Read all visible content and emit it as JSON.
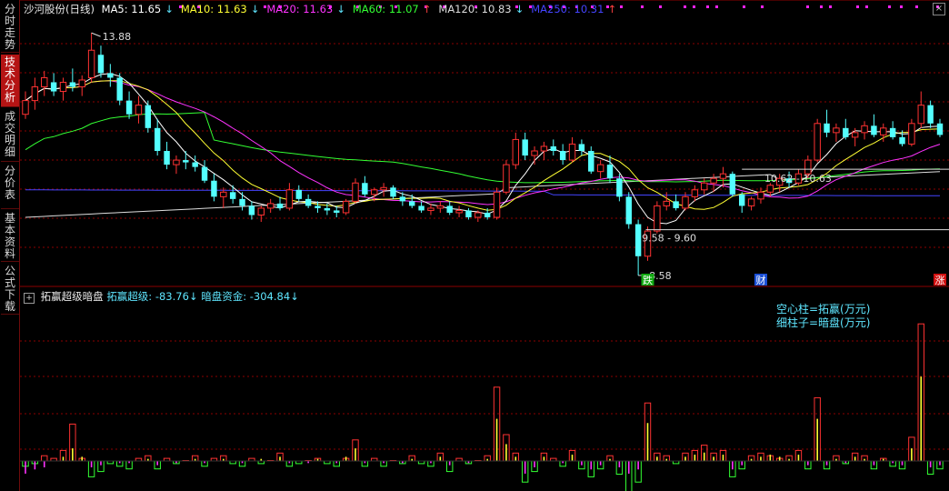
{
  "sidebar": {
    "tabs": [
      {
        "label": "分时走势",
        "active": false
      },
      {
        "label": "技术分析",
        "active": true
      },
      {
        "label": "成交明细",
        "active": false
      },
      {
        "label": "分价表",
        "active": false
      },
      {
        "label": "基本资料",
        "active": false
      },
      {
        "label": "公式下载",
        "active": false
      }
    ]
  },
  "main_header": {
    "title": "沙河股份(日线)",
    "ma": [
      {
        "label": "MA5: 11.65",
        "arrow": "↓",
        "color": "#ffffff"
      },
      {
        "label": "MA10: 11.63",
        "arrow": "↓",
        "color": "#ffff33"
      },
      {
        "label": "MA20: 11.63",
        "arrow": "↓",
        "color": "#ff33ff"
      },
      {
        "label": "MA60: 11.07",
        "arrow": "↑",
        "color": "#33ff33"
      },
      {
        "label": "MA120: 10.83",
        "arrow": "↓",
        "color": "#dddddd"
      },
      {
        "label": "MA250: 10.31",
        "arrow": "↑",
        "color": "#4444ff"
      }
    ]
  },
  "annotations": {
    "high": "13.88",
    "low": "8.58",
    "range1": "9.58 - 9.60",
    "range2": "10.62 - 10.63",
    "markers": [
      {
        "text": "跌",
        "color": "#11aa11"
      },
      {
        "text": "财",
        "color": "#1a4fd6"
      },
      {
        "text": "涨",
        "color": "#d01010"
      }
    ]
  },
  "indicator": {
    "title": "拓赢超级暗盘",
    "value1_label": "拓赢超级: -83.76",
    "value1_arrow": "↓",
    "value2_label": "暗盘资金: -304.84",
    "value2_arrow": "↓",
    "legend": [
      "空心柱=拓赢(万元)",
      "细柱子=暗盘(万元)"
    ]
  },
  "colors": {
    "up": "#ff3232",
    "down": "#54ffff",
    "ma5": "#ffffff",
    "ma10": "#ffff33",
    "ma20": "#ff33ff",
    "ma60": "#33ff33",
    "ma120": "#dddddd",
    "ma250": "#4444ff",
    "grid": "#8b0000"
  },
  "chart_data": {
    "type": "candlestick",
    "ylim": [
      8.4,
      14.2
    ],
    "ohlc": [
      [
        12.1,
        12.6,
        12.0,
        12.4
      ],
      [
        12.4,
        12.9,
        12.2,
        12.7
      ],
      [
        12.7,
        13.05,
        12.5,
        12.9
      ],
      [
        12.8,
        13.0,
        12.5,
        12.6
      ],
      [
        12.6,
        12.9,
        12.4,
        12.8
      ],
      [
        12.8,
        13.1,
        12.6,
        12.7
      ],
      [
        12.7,
        12.95,
        12.5,
        12.85
      ],
      [
        12.9,
        13.88,
        12.8,
        13.5
      ],
      [
        13.4,
        13.6,
        12.9,
        13.0
      ],
      [
        13.0,
        13.2,
        12.7,
        12.9
      ],
      [
        12.9,
        13.0,
        12.3,
        12.4
      ],
      [
        12.4,
        12.6,
        12.0,
        12.1
      ],
      [
        12.1,
        12.5,
        11.9,
        12.3
      ],
      [
        12.3,
        12.4,
        11.7,
        11.8
      ],
      [
        11.8,
        12.0,
        11.2,
        11.3
      ],
      [
        11.3,
        11.5,
        10.9,
        11.0
      ],
      [
        11.0,
        11.2,
        10.8,
        11.1
      ],
      [
        11.1,
        11.3,
        10.9,
        11.05
      ],
      [
        11.05,
        11.2,
        10.85,
        10.95
      ],
      [
        10.95,
        11.1,
        10.6,
        10.65
      ],
      [
        10.65,
        10.8,
        10.2,
        10.3
      ],
      [
        10.3,
        10.5,
        10.05,
        10.4
      ],
      [
        10.4,
        10.55,
        10.15,
        10.25
      ],
      [
        10.25,
        10.4,
        10.0,
        10.1
      ],
      [
        10.1,
        10.2,
        9.8,
        9.9
      ],
      [
        9.9,
        10.1,
        9.75,
        10.05
      ],
      [
        10.05,
        10.25,
        9.95,
        10.15
      ],
      [
        10.15,
        10.3,
        10.0,
        10.05
      ],
      [
        10.05,
        10.6,
        10.0,
        10.45
      ],
      [
        10.45,
        10.55,
        10.2,
        10.25
      ],
      [
        10.25,
        10.35,
        10.05,
        10.1
      ],
      [
        10.1,
        10.2,
        9.95,
        10.05
      ],
      [
        10.05,
        10.15,
        9.9,
        10.0
      ],
      [
        10.0,
        10.1,
        9.85,
        9.95
      ],
      [
        9.95,
        10.25,
        9.9,
        10.2
      ],
      [
        10.2,
        10.7,
        10.15,
        10.6
      ],
      [
        10.6,
        10.75,
        10.3,
        10.35
      ],
      [
        10.35,
        10.5,
        10.2,
        10.45
      ],
      [
        10.45,
        10.6,
        10.3,
        10.5
      ],
      [
        10.5,
        10.55,
        10.25,
        10.3
      ],
      [
        10.3,
        10.4,
        10.1,
        10.2
      ],
      [
        10.2,
        10.35,
        10.05,
        10.1
      ],
      [
        10.1,
        10.2,
        9.95,
        10.0
      ],
      [
        10.0,
        10.15,
        9.9,
        10.05
      ],
      [
        10.05,
        10.2,
        9.95,
        10.1
      ],
      [
        10.1,
        10.2,
        9.9,
        9.95
      ],
      [
        9.95,
        10.1,
        9.85,
        10.0
      ],
      [
        10.0,
        10.05,
        9.8,
        9.85
      ],
      [
        9.85,
        10.0,
        9.75,
        9.95
      ],
      [
        9.95,
        10.05,
        9.8,
        9.85
      ],
      [
        9.85,
        10.5,
        9.8,
        10.4
      ],
      [
        10.4,
        11.1,
        10.35,
        11.0
      ],
      [
        11.0,
        11.7,
        10.9,
        11.55
      ],
      [
        11.55,
        11.7,
        11.1,
        11.2
      ],
      [
        11.2,
        11.4,
        11.0,
        11.3
      ],
      [
        11.3,
        11.5,
        11.1,
        11.4
      ],
      [
        11.4,
        11.55,
        11.2,
        11.3
      ],
      [
        11.3,
        11.45,
        11.0,
        11.1
      ],
      [
        11.1,
        11.6,
        11.05,
        11.45
      ],
      [
        11.45,
        11.55,
        11.2,
        11.3
      ],
      [
        11.3,
        11.4,
        10.8,
        10.85
      ],
      [
        10.85,
        11.1,
        10.7,
        11.0
      ],
      [
        11.0,
        11.2,
        10.6,
        10.7
      ],
      [
        10.7,
        10.8,
        10.2,
        10.3
      ],
      [
        10.3,
        10.4,
        9.6,
        9.7
      ],
      [
        9.7,
        9.8,
        8.58,
        9.0
      ],
      [
        9.0,
        9.65,
        8.9,
        9.55
      ],
      [
        9.55,
        10.2,
        9.5,
        10.1
      ],
      [
        10.1,
        10.4,
        10.0,
        10.2
      ],
      [
        10.2,
        10.35,
        10.0,
        10.05
      ],
      [
        10.05,
        10.4,
        10.0,
        10.3
      ],
      [
        10.3,
        10.55,
        10.2,
        10.45
      ],
      [
        10.45,
        10.7,
        10.35,
        10.6
      ],
      [
        10.6,
        10.8,
        10.4,
        10.7
      ],
      [
        10.7,
        10.95,
        10.5,
        10.8
      ],
      [
        10.8,
        10.85,
        10.3,
        10.35
      ],
      [
        10.35,
        10.4,
        9.95,
        10.1
      ],
      [
        10.1,
        10.3,
        10.0,
        10.25
      ],
      [
        10.25,
        10.5,
        10.15,
        10.4
      ],
      [
        10.4,
        10.6,
        10.3,
        10.55
      ],
      [
        10.55,
        10.8,
        10.4,
        10.7
      ],
      [
        10.7,
        10.85,
        10.5,
        10.6
      ],
      [
        10.6,
        10.9,
        10.55,
        10.8
      ],
      [
        10.8,
        11.2,
        10.7,
        11.1
      ],
      [
        11.1,
        12.0,
        11.05,
        11.9
      ],
      [
        11.9,
        12.2,
        11.6,
        11.7
      ],
      [
        11.7,
        11.9,
        11.5,
        11.8
      ],
      [
        11.8,
        12.0,
        11.55,
        11.6
      ],
      [
        11.6,
        11.8,
        11.4,
        11.7
      ],
      [
        11.7,
        11.95,
        11.55,
        11.85
      ],
      [
        11.85,
        12.1,
        11.6,
        11.65
      ],
      [
        11.65,
        11.9,
        11.5,
        11.8
      ],
      [
        11.8,
        11.95,
        11.55,
        11.6
      ],
      [
        11.6,
        11.75,
        11.4,
        11.45
      ],
      [
        11.45,
        12.0,
        11.4,
        11.9
      ],
      [
        11.9,
        12.6,
        11.8,
        12.3
      ],
      [
        12.3,
        12.4,
        11.8,
        11.9
      ],
      [
        11.9,
        12.0,
        11.6,
        11.65
      ]
    ],
    "indicator_bars": [
      [
        -6,
        -2,
        0
      ],
      [
        -4,
        -1,
        1
      ],
      [
        -3,
        2,
        0
      ],
      [
        0,
        1,
        -1
      ],
      [
        2,
        4,
        1
      ],
      [
        6,
        14,
        3
      ],
      [
        2,
        1,
        0
      ],
      [
        -3,
        -6,
        -1
      ],
      [
        -2,
        -4,
        0
      ],
      [
        0,
        -1,
        1
      ],
      [
        -1,
        -2,
        0
      ],
      [
        -1,
        -3,
        -1
      ],
      [
        0,
        1,
        0
      ],
      [
        1,
        2,
        1
      ],
      [
        -2,
        -3,
        0
      ],
      [
        0,
        1,
        0
      ],
      [
        -1,
        -1,
        0
      ],
      [
        0,
        0,
        1
      ],
      [
        1,
        2,
        0
      ],
      [
        -1,
        -2,
        0
      ],
      [
        0,
        1,
        0
      ],
      [
        1,
        2,
        0
      ],
      [
        0,
        -1,
        0
      ],
      [
        -1,
        -2,
        0
      ],
      [
        0,
        1,
        0
      ],
      [
        1,
        -1,
        0
      ],
      [
        0,
        0,
        0
      ],
      [
        2,
        3,
        1
      ],
      [
        -1,
        -2,
        0
      ],
      [
        0,
        -1,
        0
      ],
      [
        -1,
        0,
        0
      ],
      [
        1,
        1,
        0
      ],
      [
        0,
        -1,
        0
      ],
      [
        -1,
        -2,
        0
      ],
      [
        2,
        1,
        0
      ],
      [
        6,
        8,
        3
      ],
      [
        -1,
        -2,
        0
      ],
      [
        0,
        1,
        0
      ],
      [
        -1,
        -2,
        0
      ],
      [
        0,
        0,
        0
      ],
      [
        -1,
        -1,
        0
      ],
      [
        1,
        2,
        0
      ],
      [
        0,
        -1,
        0
      ],
      [
        -1,
        -2,
        0
      ],
      [
        2,
        3,
        1
      ],
      [
        -2,
        -4,
        0
      ],
      [
        0,
        1,
        0
      ],
      [
        -1,
        -1,
        0
      ],
      [
        0,
        0,
        0
      ],
      [
        1,
        2,
        0
      ],
      [
        20,
        28,
        6
      ],
      [
        8,
        10,
        2
      ],
      [
        2,
        3,
        1
      ],
      [
        -6,
        -8,
        -2
      ],
      [
        -3,
        -4,
        0
      ],
      [
        2,
        3,
        1
      ],
      [
        0,
        1,
        0
      ],
      [
        -1,
        -2,
        0
      ],
      [
        3,
        4,
        1
      ],
      [
        -2,
        -3,
        0
      ],
      [
        -4,
        -6,
        -1
      ],
      [
        -2,
        -3,
        0
      ],
      [
        1,
        2,
        0
      ],
      [
        -3,
        -5,
        -1
      ],
      [
        -6,
        -12,
        -3
      ],
      [
        -4,
        -8,
        0
      ],
      [
        18,
        22,
        6
      ],
      [
        2,
        3,
        1
      ],
      [
        1,
        2,
        0
      ],
      [
        0,
        -1,
        0
      ],
      [
        2,
        3,
        0
      ],
      [
        3,
        4,
        1
      ],
      [
        4,
        6,
        1
      ],
      [
        2,
        3,
        0
      ],
      [
        3,
        4,
        0
      ],
      [
        -4,
        -6,
        -1
      ],
      [
        -2,
        -3,
        0
      ],
      [
        1,
        2,
        0
      ],
      [
        2,
        3,
        0
      ],
      [
        3,
        2,
        1
      ],
      [
        2,
        1,
        0
      ],
      [
        1,
        2,
        0
      ],
      [
        3,
        4,
        1
      ],
      [
        -2,
        -3,
        0
      ],
      [
        20,
        24,
        8
      ],
      [
        -2,
        -3,
        0
      ],
      [
        1,
        2,
        0
      ],
      [
        -1,
        -1,
        0
      ],
      [
        2,
        3,
        1
      ],
      [
        1,
        2,
        0
      ],
      [
        -2,
        -3,
        0
      ],
      [
        1,
        1,
        0
      ],
      [
        -1,
        -2,
        0
      ],
      [
        -2,
        -3,
        0
      ],
      [
        6,
        9,
        2
      ],
      [
        40,
        52,
        10
      ],
      [
        -3,
        -5,
        0
      ],
      [
        -2,
        -3,
        0
      ]
    ]
  }
}
